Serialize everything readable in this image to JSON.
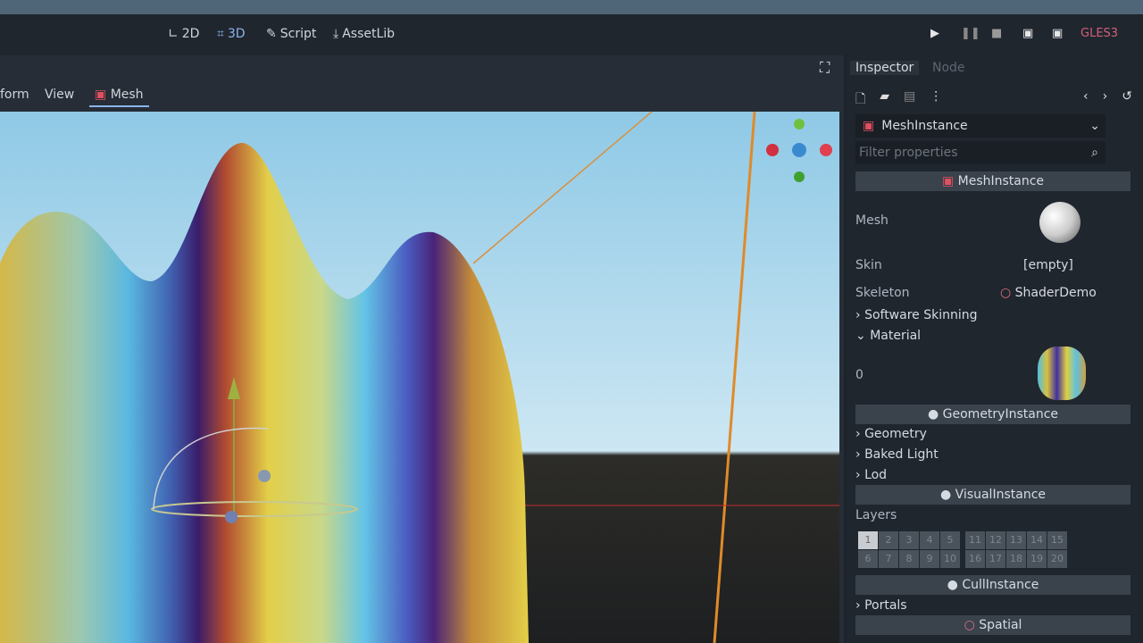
{
  "toolbar": {
    "modes": [
      {
        "label": "2D",
        "icon": "2d-icon"
      },
      {
        "label": "3D",
        "icon": "3d-icon"
      },
      {
        "label": "Script",
        "icon": "script-icon"
      },
      {
        "label": "AssetLib",
        "icon": "assetlib-icon"
      }
    ],
    "renderer": "GLES3"
  },
  "viewport": {
    "menu": [
      "form",
      "View",
      "Mesh"
    ]
  },
  "inspector": {
    "tabs": [
      "Inspector",
      "Node"
    ],
    "node_type": "MeshInstance",
    "filter_placeholder": "Filter properties",
    "sections": {
      "mesh_instance": "MeshInstance",
      "geometry_instance": "GeometryInstance",
      "visual_instance": "VisualInstance",
      "cull_instance": "CullInstance",
      "spatial": "Spatial"
    },
    "props": {
      "mesh": "Mesh",
      "skin": "Skin",
      "skin_value": "[empty]",
      "skeleton": "Skeleton",
      "skeleton_value": "ShaderDemo",
      "software_skinning": "Software Skinning",
      "material": "Material",
      "material_index": "0",
      "geometry": "Geometry",
      "baked_light": "Baked Light",
      "lod": "Lod",
      "layers": "Layers",
      "portals": "Portals"
    },
    "layers_top": [
      "1",
      "2",
      "3",
      "4",
      "5",
      "11",
      "12",
      "13",
      "14",
      "15"
    ],
    "layers_bottom": [
      "6",
      "7",
      "8",
      "9",
      "10",
      "16",
      "17",
      "18",
      "19",
      "20"
    ]
  },
  "colors": {
    "accent": "#8ab4e8",
    "renderer": "#d0607a"
  }
}
